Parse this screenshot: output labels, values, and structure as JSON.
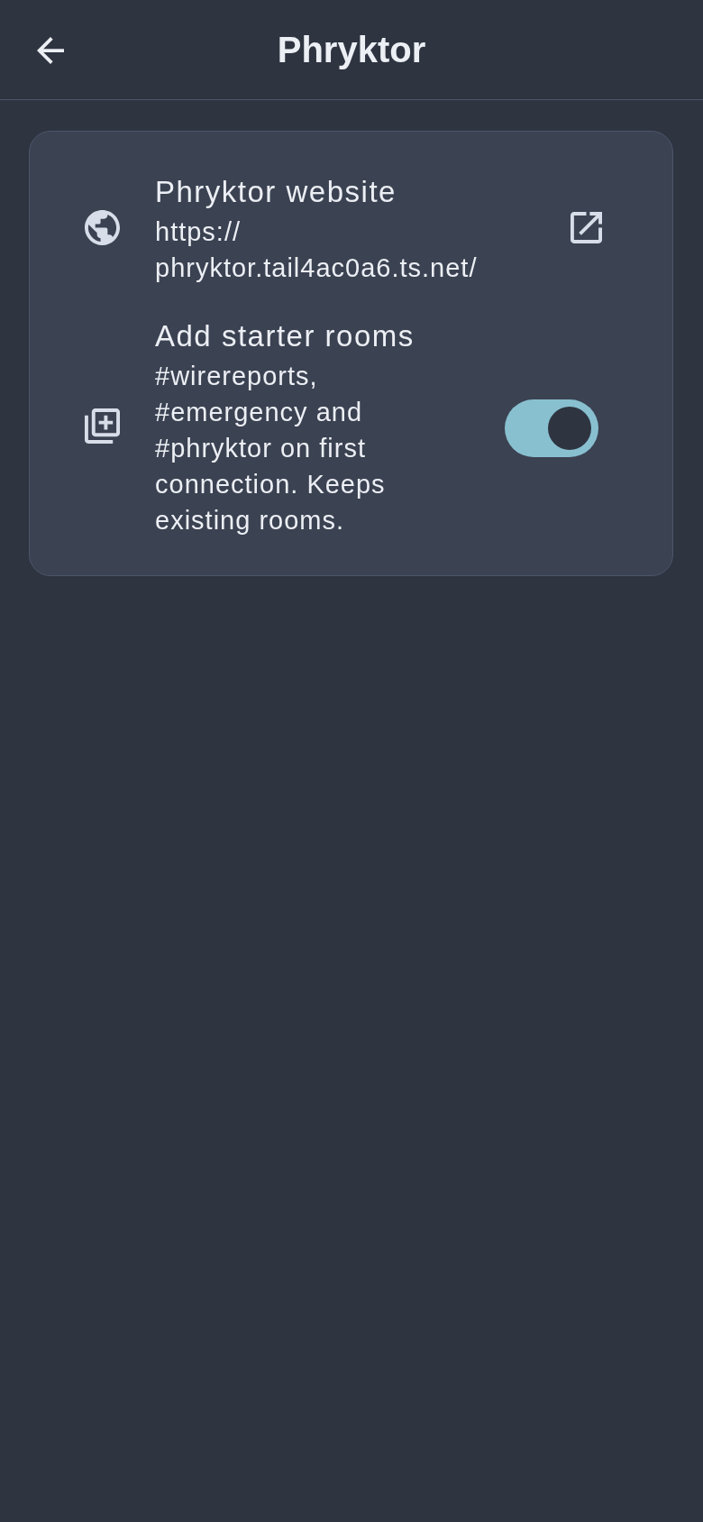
{
  "header": {
    "title": "Phryktor"
  },
  "settings": [
    {
      "kind": "link",
      "title": "Phryktor website",
      "subtitle": "https://phryktor.tail4ac0a6.ts.net/"
    },
    {
      "kind": "toggle",
      "title": "Add starter rooms",
      "subtitle": "#wirereports, #emergency and #phryktor on first connection. Keeps existing rooms.",
      "on": true
    }
  ]
}
